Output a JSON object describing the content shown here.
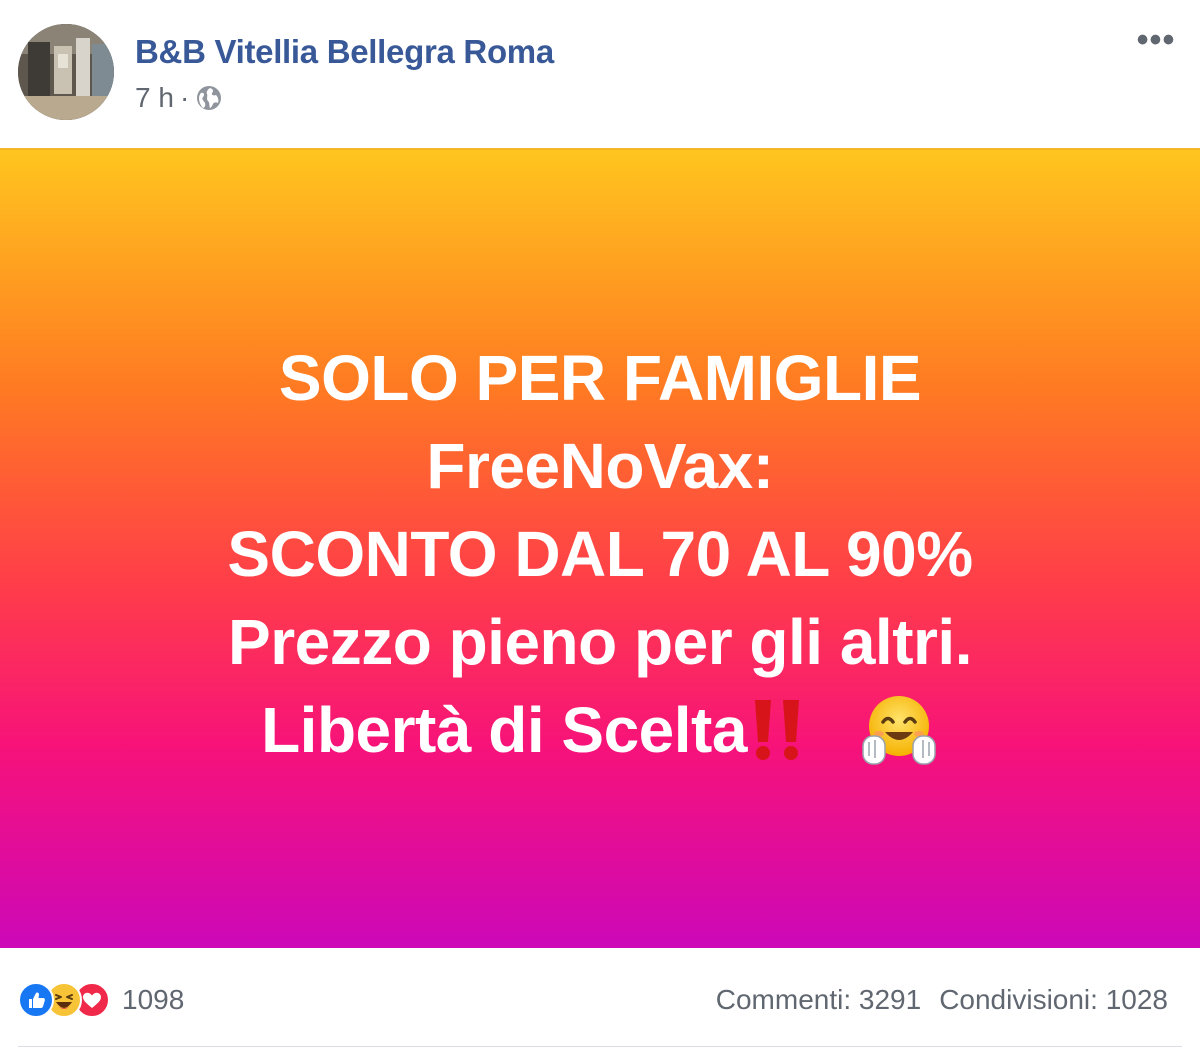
{
  "header": {
    "page_name": "B&B Vitellia Bellegra Roma",
    "time": "7 h",
    "separator": "·",
    "audience_icon": "globe-icon",
    "more_label": "•••"
  },
  "post": {
    "lines": [
      "SOLO PER FAMIGLIE",
      "FreeNoVax:",
      "SCONTO DAL 70 AL 90%",
      "Prezzo pieno per gli altri.",
      "Libertà di Scelta"
    ],
    "emojis": [
      "double-exclamation-icon",
      "hugging-face-icon"
    ],
    "colors": {
      "text": "#ffffff",
      "gradient_top": "#ffc61e",
      "gradient_mid": "#ff3c4a",
      "gradient_bottom": "#cc08b8"
    }
  },
  "footer": {
    "reaction_icons": [
      "like-icon",
      "haha-icon",
      "love-icon"
    ],
    "reaction_count": "1098",
    "comments": "Commenti: 3291",
    "shares": "Condivisioni: 1028"
  },
  "colors": {
    "link": "#385898",
    "meta": "#616770"
  }
}
